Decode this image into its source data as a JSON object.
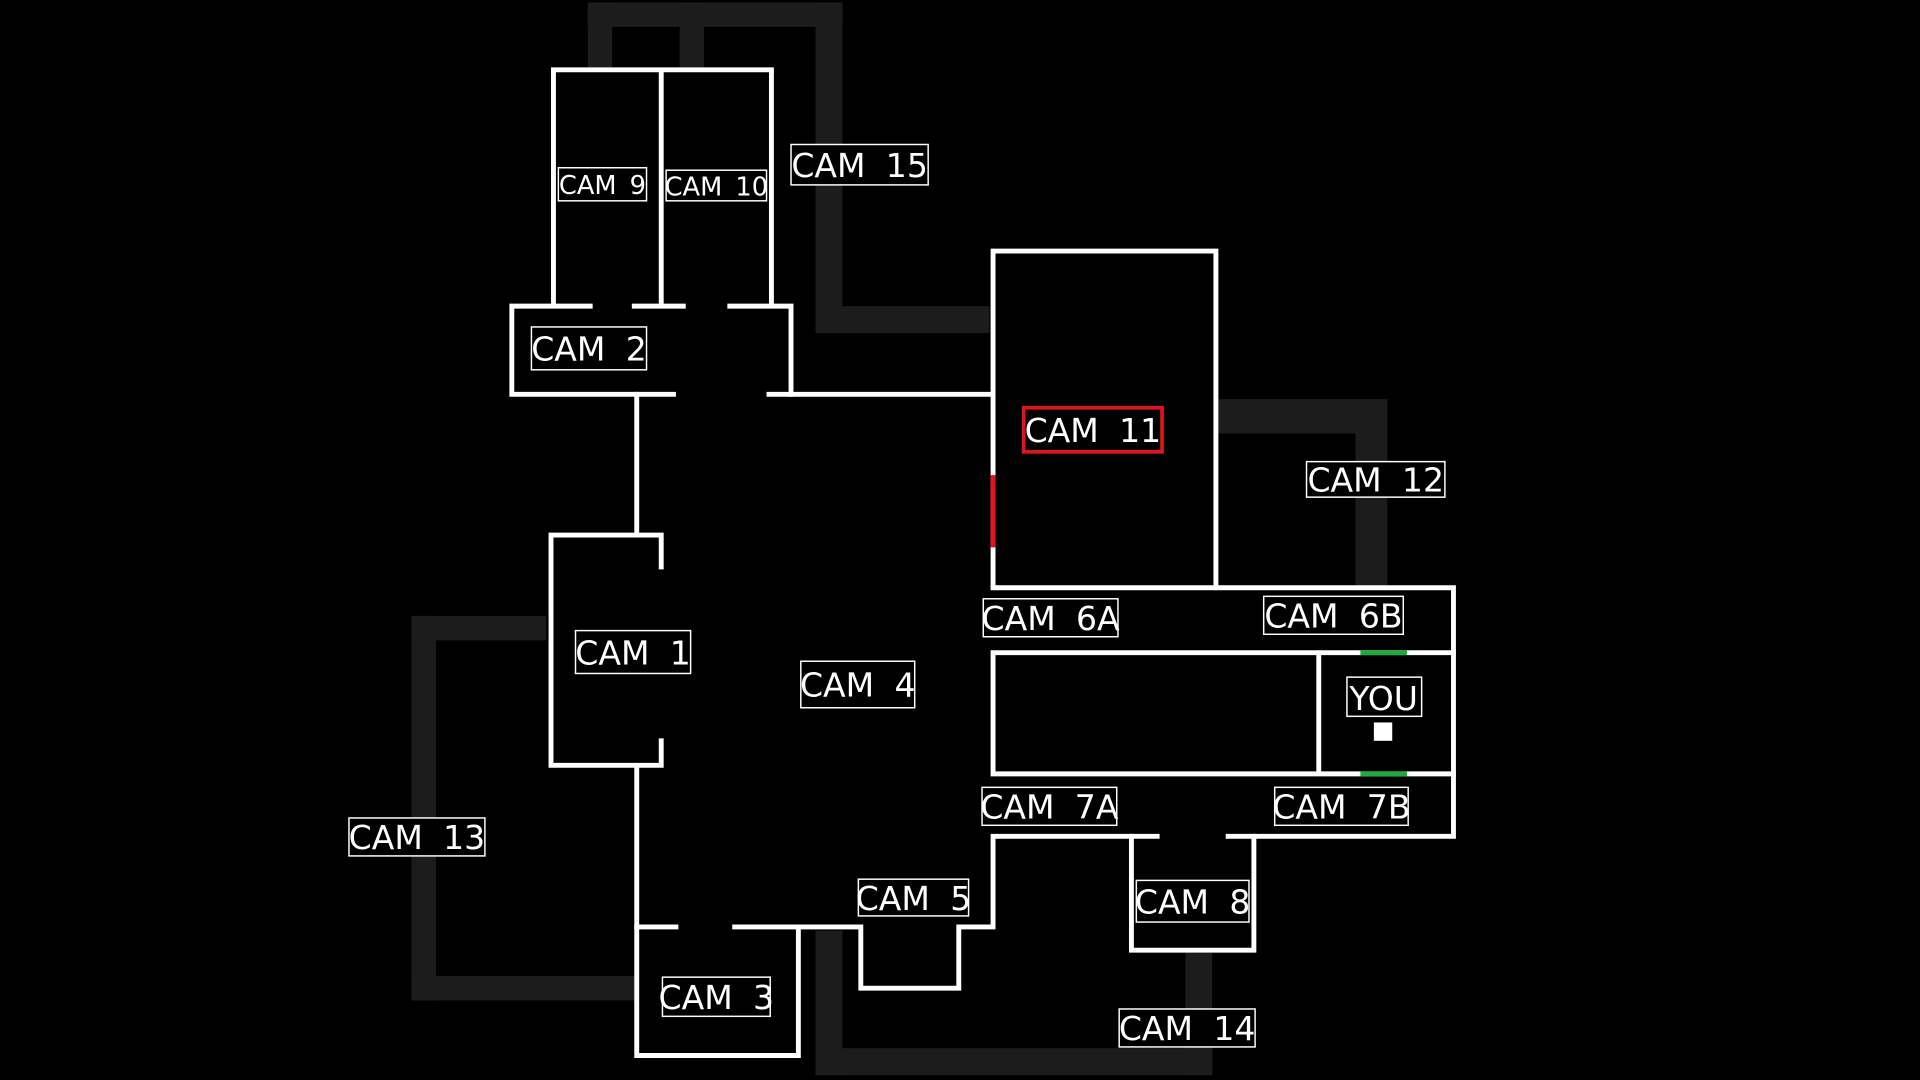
{
  "map": {
    "selected_camera": "CAM 11",
    "colors": {
      "selected": "#e0141e",
      "door_open": "#1faa3c",
      "corridor": "#1c1c1c",
      "wall": "#ffffff"
    },
    "cameras": [
      {
        "id": "cam-9",
        "label": "CAM 9"
      },
      {
        "id": "cam-10",
        "label": "CAM 10"
      },
      {
        "id": "cam-15",
        "label": "CAM 15"
      },
      {
        "id": "cam-2",
        "label": "CAM 2"
      },
      {
        "id": "cam-11",
        "label": "CAM 11"
      },
      {
        "id": "cam-12",
        "label": "CAM 12"
      },
      {
        "id": "cam-1",
        "label": "CAM 1"
      },
      {
        "id": "cam-4",
        "label": "CAM 4"
      },
      {
        "id": "cam-6a",
        "label": "CAM 6A"
      },
      {
        "id": "cam-6b",
        "label": "CAM 6B"
      },
      {
        "id": "cam-7a",
        "label": "CAM 7A"
      },
      {
        "id": "cam-7b",
        "label": "CAM 7B"
      },
      {
        "id": "cam-13",
        "label": "CAM 13"
      },
      {
        "id": "cam-5",
        "label": "CAM 5"
      },
      {
        "id": "cam-8",
        "label": "CAM 8"
      },
      {
        "id": "cam-3",
        "label": "CAM 3"
      },
      {
        "id": "cam-14",
        "label": "CAM 14"
      }
    ],
    "player": {
      "label": "YOU",
      "icon": "player-marker-icon"
    }
  }
}
